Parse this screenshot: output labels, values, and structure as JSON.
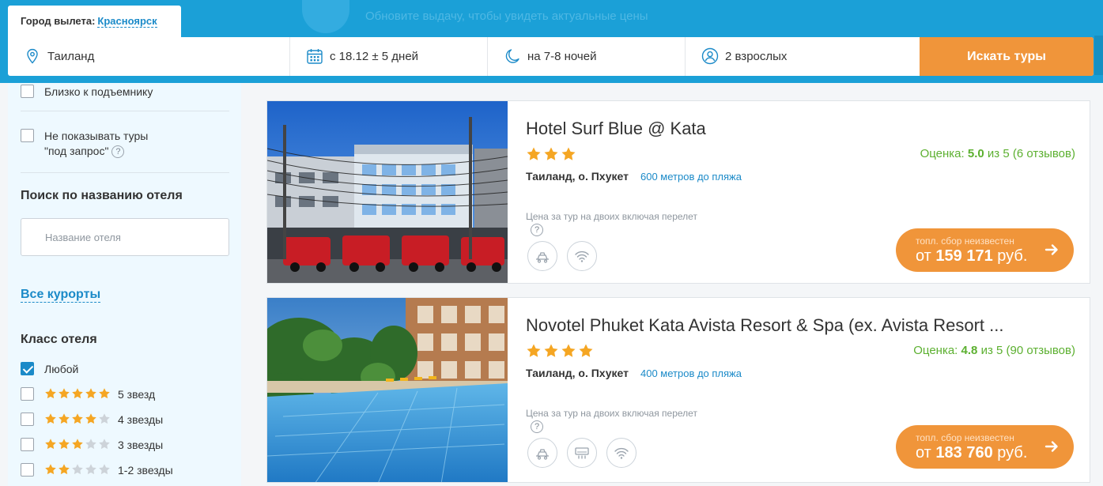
{
  "header": {
    "update_hint": "Обновите выдачу, чтобы увидеть актуальные цены",
    "city_label": "Город вылета:",
    "city_value": "Красноярск",
    "destination": "Таиланд",
    "dates": "с 18.12 ± 5 дней",
    "nights": "на 7-8 ночей",
    "people": "2 взрослых",
    "search_button": "Искать туры"
  },
  "sidebar": {
    "near_lift": "Близко к подъемнику",
    "no_request_line1": "Не показывать туры",
    "no_request_line2": "\"под запрос\"",
    "qmark": "?",
    "hotel_search_title": "Поиск по названию отеля",
    "hotel_search_placeholder": "Название отеля",
    "all_resorts": "Все курорты",
    "hotel_class_title": "Класс отеля",
    "class_options": [
      {
        "label": "Любой",
        "checked": true,
        "stars": 0
      },
      {
        "label": "5 звезд",
        "checked": false,
        "stars": 5
      },
      {
        "label": "4 звезды",
        "checked": false,
        "stars": 4
      },
      {
        "label": "3 звезды",
        "checked": false,
        "stars": 3
      },
      {
        "label": "1-2 звезды",
        "checked": false,
        "stars": 2
      }
    ]
  },
  "hotels": [
    {
      "name": "Hotel Surf Blue @ Kata",
      "stars": 3,
      "rating_label": "Оценка:",
      "rating_value": "5.0",
      "rating_rest": "из 5 (6 отзывов)",
      "location": "Таиланд, о. Пхукет",
      "beach": "600 метров до пляжа",
      "price_note": "Цена за тур на двоих включая перелет",
      "price_sub": "топл. сбор неизвестен",
      "price_prefix": "от",
      "price_value": "159 171",
      "price_currency": "руб.",
      "amenities": [
        "transfer-icon",
        "wifi-icon"
      ]
    },
    {
      "name": "Novotel Phuket Kata Avista Resort & Spa (ex. Avista Resort ...",
      "stars": 4,
      "rating_label": "Оценка:",
      "rating_value": "4.8",
      "rating_rest": "из 5 (90 отзывов)",
      "location": "Таиланд, о. Пхукет",
      "beach": "400 метров до пляжа",
      "price_note": "Цена за тур на двоих включая перелет",
      "price_sub": "топл. сбор неизвестен",
      "price_prefix": "от",
      "price_value": "183 760",
      "price_currency": "руб.",
      "amenities": [
        "transfer-icon",
        "air-conditioner-icon",
        "wifi-icon"
      ]
    }
  ],
  "colors": {
    "brand_blue": "#1ba0d7",
    "accent_orange": "#f0953a",
    "rating_green": "#5cb030",
    "link_blue": "#1b8ac8",
    "star": "#f5a623"
  }
}
